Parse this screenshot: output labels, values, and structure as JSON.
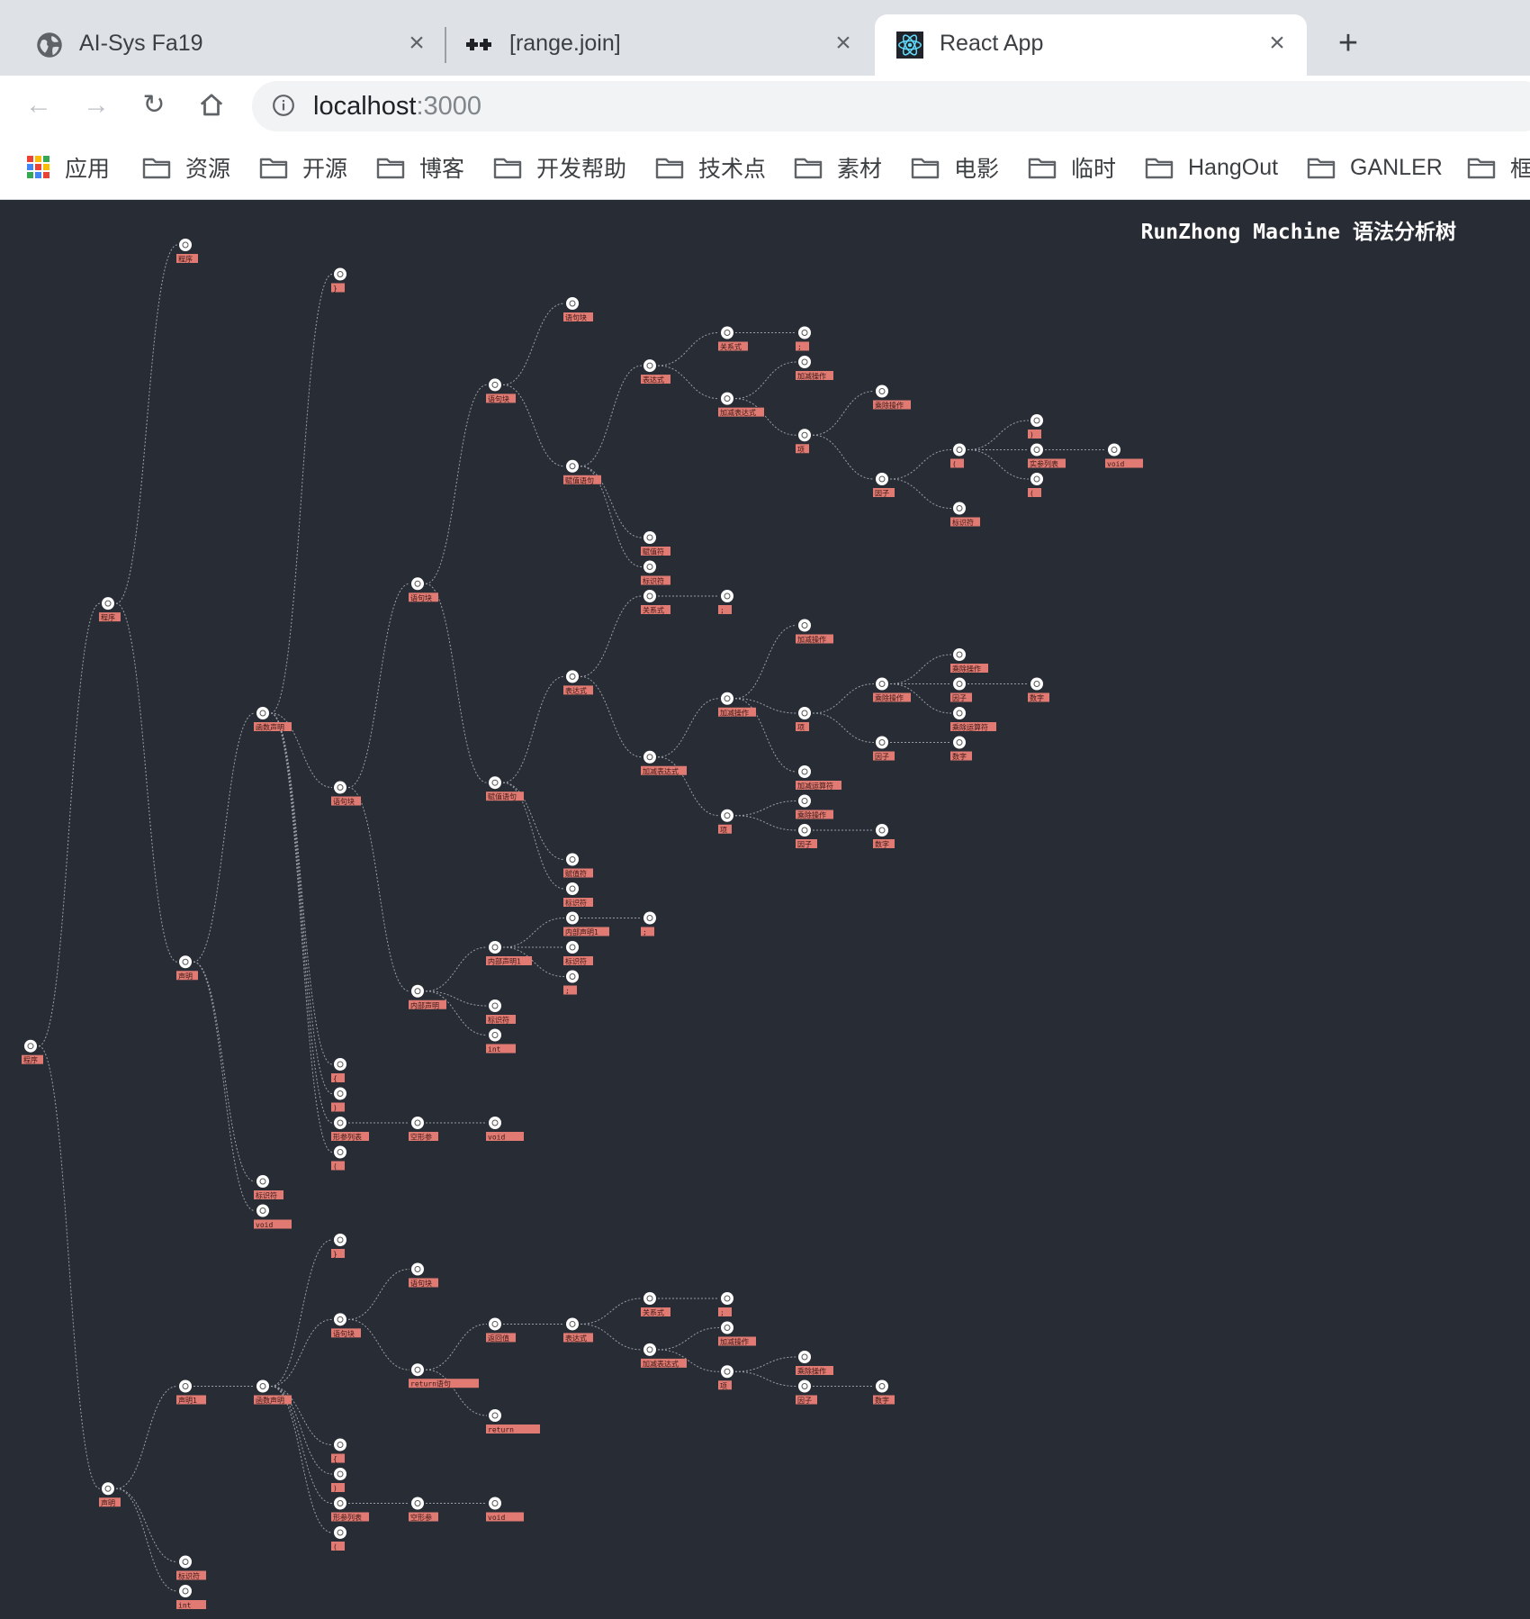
{
  "browser": {
    "tabs": [
      {
        "title": "AI-Sys Fa19",
        "icon": "globe-icon",
        "active": false
      },
      {
        "title": "[range.join]",
        "icon": "plus-plus-icon",
        "active": false
      },
      {
        "title": "React App",
        "icon": "react-icon",
        "active": true
      }
    ],
    "new_tab": "+",
    "url": {
      "host": "localhost",
      "port": ":3000"
    },
    "bookmarks": [
      {
        "label": "应用",
        "icon": "apps-grid-icon"
      },
      {
        "label": "资源",
        "icon": "folder-icon"
      },
      {
        "label": "开源",
        "icon": "folder-icon"
      },
      {
        "label": "博客",
        "icon": "folder-icon"
      },
      {
        "label": "开发帮助",
        "icon": "folder-icon"
      },
      {
        "label": "技术点",
        "icon": "folder-icon"
      },
      {
        "label": "素材",
        "icon": "folder-icon"
      },
      {
        "label": "电影",
        "icon": "folder-icon"
      },
      {
        "label": "临时",
        "icon": "folder-icon"
      },
      {
        "label": "HangOut",
        "icon": "folder-icon"
      },
      {
        "label": "GANLER",
        "icon": "folder-icon"
      },
      {
        "label": "框",
        "icon": "folder-icon"
      }
    ]
  },
  "app": {
    "title": "RunZhong Machine 语法分析树",
    "colors": {
      "background": "#282c34",
      "node": "#ffffff",
      "label_bg": "#e07a72",
      "edge": "#9a9ea6"
    },
    "node_symbol": "⊙",
    "tree": {
      "t": "程序",
      "c": [
        {
          "t": "程序",
          "c": [
            {
              "t": "程序"
            },
            {
              "t": "声明",
              "c": [
                {
                  "t": "函数声明",
                  "c": [
                    {
                      "t": "}"
                    },
                    {
                      "t": "语句块",
                      "c": [
                        {
                          "t": "语句块",
                          "c": [
                            {
                              "t": "语句块",
                              "c": [
                                {
                                  "t": "语句块"
                                },
                                {
                                  "t": "赋值语句",
                                  "c": [
                                    {
                                      "t": "表达式",
                                      "c": [
                                        {
                                          "t": "关系式",
                                          "c": [
                                            {
                                              "t": ";"
                                            }
                                          ]
                                        },
                                        {
                                          "t": "加减表达式",
                                          "c": [
                                            {
                                              "t": "加减操作"
                                            },
                                            {
                                              "t": "项",
                                              "c": [
                                                {
                                                  "t": "乘除操作"
                                                },
                                                {
                                                  "t": "因子",
                                                  "c": [
                                                    {
                                                      "t": "(",
                                                      "c": [
                                                        {
                                                          "t": ")"
                                                        },
                                                        {
                                                          "t": "实参列表",
                                                          "c": [
                                                            {
                                                              "t": "void"
                                                            }
                                                          ]
                                                        },
                                                        {
                                                          "t": "("
                                                        }
                                                      ]
                                                    },
                                                    {
                                                      "t": "标识符"
                                                    }
                                                  ]
                                                }
                                              ]
                                            }
                                          ]
                                        }
                                      ]
                                    },
                                    {
                                      "t": "赋值符"
                                    },
                                    {
                                      "t": "标识符"
                                    }
                                  ]
                                }
                              ]
                            },
                            {
                              "t": "赋值语句",
                              "c": [
                                {
                                  "t": "表达式",
                                  "c": [
                                    {
                                      "t": "关系式",
                                      "c": [
                                        {
                                          "t": ";"
                                        }
                                      ]
                                    },
                                    {
                                      "t": "加减表达式",
                                      "c": [
                                        {
                                          "t": "加减操作",
                                          "c": [
                                            {
                                              "t": "加减操作"
                                            },
                                            {
                                              "t": "项",
                                              "c": [
                                                {
                                                  "t": "乘除操作",
                                                  "c": [
                                                    {
                                                      "t": "乘除操作"
                                                    },
                                                    {
                                                      "t": "因子",
                                                      "c": [
                                                        {
                                                          "t": "数字"
                                                        }
                                                      ]
                                                    },
                                                    {
                                                      "t": "乘除运算符"
                                                    }
                                                  ]
                                                },
                                                {
                                                  "t": "因子",
                                                  "c": [
                                                    {
                                                      "t": "数字"
                                                    }
                                                  ]
                                                }
                                              ]
                                            },
                                            {
                                              "t": "加减运算符"
                                            }
                                          ]
                                        },
                                        {
                                          "t": "项",
                                          "c": [
                                            {
                                              "t": "乘除操作"
                                            },
                                            {
                                              "t": "因子",
                                              "c": [
                                                {
                                                  "t": "数字"
                                                }
                                              ]
                                            }
                                          ]
                                        }
                                      ]
                                    }
                                  ]
                                },
                                {
                                  "t": "赋值符"
                                },
                                {
                                  "t": "标识符"
                                }
                              ]
                            }
                          ]
                        },
                        {
                          "t": "内部声明",
                          "c": [
                            {
                              "t": "内部声明1",
                              "c": [
                                {
                                  "t": "内部声明1",
                                  "c": [
                                    {
                                      "t": ";"
                                    }
                                  ]
                                },
                                {
                                  "t": "标识符"
                                },
                                {
                                  "t": ";"
                                }
                              ]
                            },
                            {
                              "t": "标识符"
                            },
                            {
                              "t": "int"
                            }
                          ]
                        }
                      ]
                    },
                    {
                      "t": "{"
                    },
                    {
                      "t": ")"
                    },
                    {
                      "t": "形参列表",
                      "c": [
                        {
                          "t": "空形参",
                          "c": [
                            {
                              "t": "void"
                            }
                          ]
                        }
                      ]
                    },
                    {
                      "t": "("
                    }
                  ]
                },
                {
                  "t": "标识符"
                },
                {
                  "t": "void"
                }
              ]
            }
          ]
        },
        {
          "t": "声明",
          "c": [
            {
              "t": "声明1",
              "c": [
                {
                  "t": "函数声明",
                  "c": [
                    {
                      "t": "}"
                    },
                    {
                      "t": "语句块",
                      "c": [
                        {
                          "t": "语句块"
                        },
                        {
                          "t": "return语句",
                          "c": [
                            {
                              "t": "返回值",
                              "c": [
                                {
                                  "t": "表达式",
                                  "c": [
                                    {
                                      "t": "关系式",
                                      "c": [
                                        {
                                          "t": ";"
                                        }
                                      ]
                                    },
                                    {
                                      "t": "加减表达式",
                                      "c": [
                                        {
                                          "t": "加减操作"
                                        },
                                        {
                                          "t": "项",
                                          "c": [
                                            {
                                              "t": "乘除操作"
                                            },
                                            {
                                              "t": "因子",
                                              "c": [
                                                {
                                                  "t": "数字"
                                                }
                                              ]
                                            }
                                          ]
                                        }
                                      ]
                                    }
                                  ]
                                }
                              ]
                            },
                            {
                              "t": "return"
                            }
                          ]
                        }
                      ]
                    },
                    {
                      "t": "{"
                    },
                    {
                      "t": ")"
                    },
                    {
                      "t": "形参列表",
                      "c": [
                        {
                          "t": "空形参",
                          "c": [
                            {
                              "t": "void"
                            }
                          ]
                        }
                      ]
                    },
                    {
                      "t": "("
                    }
                  ]
                }
              ]
            },
            {
              "t": "标识符"
            },
            {
              "t": "int"
            }
          ]
        }
      ]
    }
  }
}
